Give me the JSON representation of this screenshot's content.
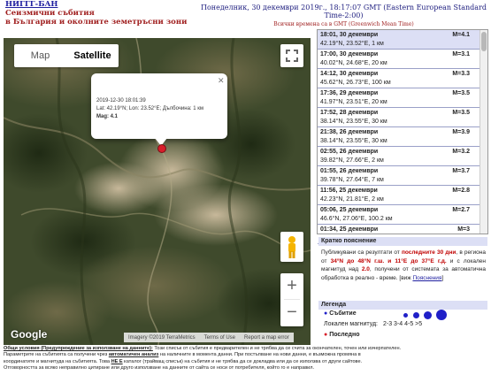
{
  "header": {
    "org_link": "НИГГГ-БАН",
    "title_line1": "Сеизмични събития",
    "title_line2": "в България и околните земетръсни зони",
    "datetime": "Понеделник, 30 декември 2019г., 18:17:07 GMT (Eastern European Standard Time-2:00)",
    "gmt_note": "Всички времена са в GMT (Greenwich Mean Time)"
  },
  "map": {
    "map_label": "Map",
    "satellite_label": "Satellite",
    "info_window": {
      "datetime": "2019-12-30 18:01:39",
      "coords": "Lat: 42.19°N; Lon: 23.52°E; Дълбочина: 1 км",
      "mag": "Mag: 4.1"
    },
    "google": "Google",
    "attribution": {
      "imagery": "Imagery ©2019 TerraMetrics",
      "terms": "Terms of Use",
      "report": "Report a map error"
    }
  },
  "events": [
    {
      "datetime": "18:01, 30 декември",
      "mag": "M=4.1",
      "location": "42.19°N, 23.52°E, 1 км"
    },
    {
      "datetime": "17:00, 30 декември",
      "mag": "M=3.1",
      "location": "40.02°N, 24.68°E, 20 км"
    },
    {
      "datetime": "14:12, 30 декември",
      "mag": "M=3.3",
      "location": "45.62°N, 26.73°E, 100 км"
    },
    {
      "datetime": "17:36, 29 декември",
      "mag": "M=3.5",
      "location": "41.97°N, 23.51°E, 20 км"
    },
    {
      "datetime": "17:52, 28 декември",
      "mag": "M=3.5",
      "location": "38.14°N, 23.55°E, 30 км"
    },
    {
      "datetime": "21:38, 26 декември",
      "mag": "M=3.9",
      "location": "38.14°N, 23.55°E, 30 км"
    },
    {
      "datetime": "02:55, 26 декември",
      "mag": "M=3.2",
      "location": "39.82°N, 27.66°E, 2 км"
    },
    {
      "datetime": "01:55, 26 декември",
      "mag": "M=3.7",
      "location": "39.78°N, 27.64°E, 7 км"
    },
    {
      "datetime": "11:56, 25 декември",
      "mag": "M=2.8",
      "location": "42.23°N, 21.81°E, 2 км"
    },
    {
      "datetime": "05:06, 25 декември",
      "mag": "M=2.7",
      "location": "46.6°N, 27.06°E, 100.2 км"
    },
    {
      "datetime": "01:34, 25 декември",
      "mag": "M=3",
      "location": ""
    }
  ],
  "explanation": {
    "title": "Кратко пояснение",
    "p1": "Публикувани са резултати от ",
    "p1_red1": "последните 30 дни",
    "p2": ", в региона от ",
    "p2_red": "34°N до 48°N г.ш. и 11°E до 37°E г.д.",
    "p3": " и с локален магнитуд над ",
    "p3_red": "2.0",
    "p4": ", получени от системата за автоматична обработка в реално - време. [виж ",
    "link": "Пояснения",
    "p5": "]"
  },
  "legend": {
    "title": "Легенда",
    "event_label": "Събитие",
    "magnitude_label": "Локален магнитуд:",
    "magnitude_scale": "2-3 3-4 4-5 >5",
    "latest_label": "Последно"
  },
  "footer": {
    "line1_bold": "Общи условия (Предупреждение за използване на данните):",
    "line1": " Този списък от събития е предварителен и не трябва да се счита за окончателен, точен или изчерпателен.",
    "line2a": "Параметрите на събитията са получени чрез ",
    "line2_bold": "автоматичен анализ",
    "line2b": " на наличните в момента данни. При постъпване на нови данни, е възможна промяна в",
    "line3a": "координатите и магнитуда на събитията. Това ",
    "line3_bold": "НЕ Е",
    "line3b": " каталог (трайващ списък) на събития и не трябва да се докладва или да се използва от други сайтове.",
    "line4": "Отговорността за всяко неправилно цитиране или друго използване на данните от сайта се носи от потребителя, който го е направил."
  },
  "colors": {
    "accent": "#2020a0",
    "highlight": "#dcdff5",
    "marker": "#d81e2a",
    "event_dot": "#2020c8"
  }
}
